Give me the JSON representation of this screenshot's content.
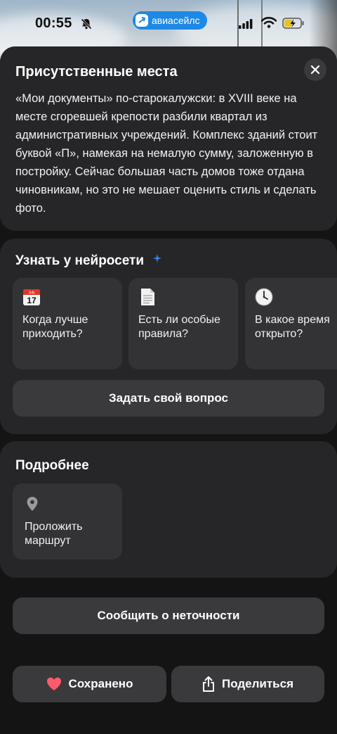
{
  "status_bar": {
    "time": "00:55",
    "app_name": "авиасейлс"
  },
  "about": {
    "title": "Присутственные места",
    "description": "«Мои документы» по-старокалужски: в XVIII веке на месте сгоревшей крепости разбили квартал из административных учреждений. Комплекс зданий стоит буквой «П», намекая на немалую сумму, заложенную в постройку. Сейчас большая часть домов тоже отдана чиновникам, но это не мешает оценить стиль и сделать фото."
  },
  "ai": {
    "title": "Узнать у нейросети",
    "accent_color": "#2d8cff",
    "questions": [
      {
        "icon": "calendar-icon",
        "label": "Когда лучше приходить?",
        "calendar_month": "July",
        "calendar_day": "17"
      },
      {
        "icon": "document-icon",
        "label": "Есть ли особые правила?"
      },
      {
        "icon": "clock-icon",
        "label": "В какое время открыто?"
      }
    ],
    "ask_label": "Задать свой вопрос"
  },
  "more": {
    "title": "Подробнее",
    "route_label": "Проложить маршрут"
  },
  "actions": {
    "report_label": "Сообщить о неточности",
    "saved_label": "Сохранено",
    "share_label": "Поделиться",
    "heart_color": "#ff5a6e"
  }
}
